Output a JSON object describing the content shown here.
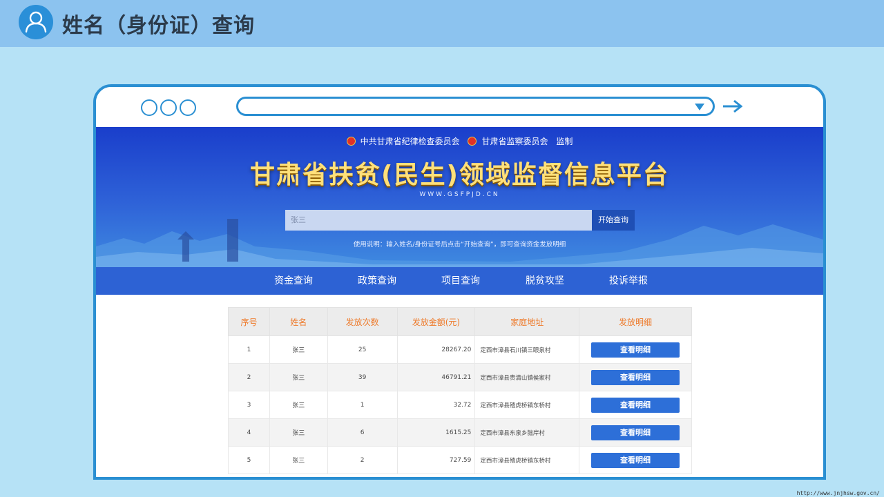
{
  "slide": {
    "title": "姓名（身份证）查询"
  },
  "site": {
    "supervisors": [
      "中共甘肃省纪律检查委员会",
      "甘肃省监察委员会",
      "监制"
    ],
    "title": "甘肃省扶贫(民生)领域监督信息平台",
    "url": "WWW.GSFPJD.CN",
    "search": {
      "value": "张三",
      "button_label": "开始查询"
    },
    "usage": "使用说明：输入姓名/身份证号后点击“开始查询”，即可查询资金发放明细",
    "nav": [
      "资金查询",
      "政策查询",
      "项目查询",
      "脱贫攻坚",
      "投诉举报"
    ]
  },
  "table": {
    "headers": [
      "序号",
      "姓名",
      "发放次数",
      "发放金额(元)",
      "家庭地址",
      "发放明细"
    ],
    "rows": [
      [
        "1",
        "张三",
        "25",
        "28267.20",
        "定西市漳县石川镇三眼泉村",
        "查看明细"
      ],
      [
        "2",
        "张三",
        "39",
        "46791.21",
        "定西市漳县贵清山镇侯家村",
        "查看明细"
      ],
      [
        "3",
        "张三",
        "1",
        "32.72",
        "定西市漳县殪虎桥镇东桥村",
        "查看明细"
      ],
      [
        "4",
        "张三",
        "6",
        "1615.25",
        "定西市漳县东泉乡朏岸村",
        "查看明细"
      ],
      [
        "5",
        "张三",
        "2",
        "727.59",
        "定西市漳县殪虎桥镇东桥村",
        "查看明细"
      ]
    ]
  },
  "footer": {
    "watermark": "http://www.jnjhsw.gov.cn/"
  },
  "colors": {
    "accent": "#2a8fd2",
    "header_text": "#ee7a2a",
    "nav_bg": "#2d62d4",
    "button_bg": "#2d6fd8"
  }
}
